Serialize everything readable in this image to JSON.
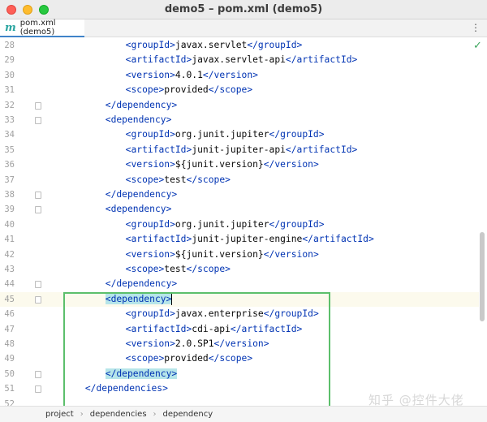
{
  "window": {
    "title": "demo5 – pom.xml (demo5)"
  },
  "tab": {
    "icon": "m",
    "label": "pom.xml (demo5)",
    "menu": "⋮"
  },
  "editor": {
    "status_icon": "✓",
    "lines": [
      {
        "num": "28",
        "indent": 6,
        "parts": [
          [
            "t",
            "<"
          ],
          [
            "n",
            "groupId"
          ],
          [
            "t",
            ">"
          ],
          [
            "x",
            "javax.servlet"
          ],
          [
            "t",
            "</"
          ],
          [
            "n",
            "groupId"
          ],
          [
            "t",
            ">"
          ]
        ]
      },
      {
        "num": "29",
        "indent": 6,
        "parts": [
          [
            "t",
            "<"
          ],
          [
            "n",
            "artifactId"
          ],
          [
            "t",
            ">"
          ],
          [
            "x",
            "javax.servlet-api"
          ],
          [
            "t",
            "</"
          ],
          [
            "n",
            "artifactId"
          ],
          [
            "t",
            ">"
          ]
        ]
      },
      {
        "num": "30",
        "indent": 6,
        "parts": [
          [
            "t",
            "<"
          ],
          [
            "n",
            "version"
          ],
          [
            "t",
            ">"
          ],
          [
            "x",
            "4.0.1"
          ],
          [
            "t",
            "</"
          ],
          [
            "n",
            "version"
          ],
          [
            "t",
            ">"
          ]
        ]
      },
      {
        "num": "31",
        "indent": 6,
        "parts": [
          [
            "t",
            "<"
          ],
          [
            "n",
            "scope"
          ],
          [
            "t",
            ">"
          ],
          [
            "x",
            "provided"
          ],
          [
            "t",
            "</"
          ],
          [
            "n",
            "scope"
          ],
          [
            "t",
            ">"
          ]
        ]
      },
      {
        "num": "32",
        "indent": 4,
        "fold": true,
        "parts": [
          [
            "t",
            "</"
          ],
          [
            "n",
            "dependency"
          ],
          [
            "t",
            ">"
          ]
        ]
      },
      {
        "num": "33",
        "indent": 4,
        "fold": true,
        "parts": [
          [
            "t",
            "<"
          ],
          [
            "n",
            "dependency"
          ],
          [
            "t",
            ">"
          ]
        ]
      },
      {
        "num": "34",
        "indent": 6,
        "parts": [
          [
            "t",
            "<"
          ],
          [
            "n",
            "groupId"
          ],
          [
            "t",
            ">"
          ],
          [
            "x",
            "org.junit.jupiter"
          ],
          [
            "t",
            "</"
          ],
          [
            "n",
            "groupId"
          ],
          [
            "t",
            ">"
          ]
        ]
      },
      {
        "num": "35",
        "indent": 6,
        "parts": [
          [
            "t",
            "<"
          ],
          [
            "n",
            "artifactId"
          ],
          [
            "t",
            ">"
          ],
          [
            "x",
            "junit-jupiter-api"
          ],
          [
            "t",
            "</"
          ],
          [
            "n",
            "artifactId"
          ],
          [
            "t",
            ">"
          ]
        ]
      },
      {
        "num": "36",
        "indent": 6,
        "parts": [
          [
            "t",
            "<"
          ],
          [
            "n",
            "version"
          ],
          [
            "t",
            ">"
          ],
          [
            "x",
            "${junit.version}"
          ],
          [
            "t",
            "</"
          ],
          [
            "n",
            "version"
          ],
          [
            "t",
            ">"
          ]
        ]
      },
      {
        "num": "37",
        "indent": 6,
        "parts": [
          [
            "t",
            "<"
          ],
          [
            "n",
            "scope"
          ],
          [
            "t",
            ">"
          ],
          [
            "x",
            "test"
          ],
          [
            "t",
            "</"
          ],
          [
            "n",
            "scope"
          ],
          [
            "t",
            ">"
          ]
        ]
      },
      {
        "num": "38",
        "indent": 4,
        "fold": true,
        "parts": [
          [
            "t",
            "</"
          ],
          [
            "n",
            "dependency"
          ],
          [
            "t",
            ">"
          ]
        ]
      },
      {
        "num": "39",
        "indent": 4,
        "fold": true,
        "parts": [
          [
            "t",
            "<"
          ],
          [
            "n",
            "dependency"
          ],
          [
            "t",
            ">"
          ]
        ]
      },
      {
        "num": "40",
        "indent": 6,
        "parts": [
          [
            "t",
            "<"
          ],
          [
            "n",
            "groupId"
          ],
          [
            "t",
            ">"
          ],
          [
            "x",
            "org.junit.jupiter"
          ],
          [
            "t",
            "</"
          ],
          [
            "n",
            "groupId"
          ],
          [
            "t",
            ">"
          ]
        ]
      },
      {
        "num": "41",
        "indent": 6,
        "parts": [
          [
            "t",
            "<"
          ],
          [
            "n",
            "artifactId"
          ],
          [
            "t",
            ">"
          ],
          [
            "x",
            "junit-jupiter-engine"
          ],
          [
            "t",
            "</"
          ],
          [
            "n",
            "artifactId"
          ],
          [
            "t",
            ">"
          ]
        ]
      },
      {
        "num": "42",
        "indent": 6,
        "parts": [
          [
            "t",
            "<"
          ],
          [
            "n",
            "version"
          ],
          [
            "t",
            ">"
          ],
          [
            "x",
            "${junit.version}"
          ],
          [
            "t",
            "</"
          ],
          [
            "n",
            "version"
          ],
          [
            "t",
            ">"
          ]
        ]
      },
      {
        "num": "43",
        "indent": 6,
        "parts": [
          [
            "t",
            "<"
          ],
          [
            "n",
            "scope"
          ],
          [
            "t",
            ">"
          ],
          [
            "x",
            "test"
          ],
          [
            "t",
            "</"
          ],
          [
            "n",
            "scope"
          ],
          [
            "t",
            ">"
          ]
        ]
      },
      {
        "num": "44",
        "indent": 4,
        "fold": true,
        "parts": [
          [
            "t",
            "</"
          ],
          [
            "n",
            "dependency"
          ],
          [
            "t",
            ">"
          ]
        ]
      },
      {
        "num": "45",
        "indent": 4,
        "fold": true,
        "current": true,
        "highlight": true,
        "caret": true,
        "parts": [
          [
            "t",
            "<"
          ],
          [
            "n",
            "dependency"
          ],
          [
            "t",
            ">"
          ]
        ]
      },
      {
        "num": "46",
        "indent": 6,
        "parts": [
          [
            "t",
            "<"
          ],
          [
            "n",
            "groupId"
          ],
          [
            "t",
            ">"
          ],
          [
            "x",
            "javax.enterprise"
          ],
          [
            "t",
            "</"
          ],
          [
            "n",
            "groupId"
          ],
          [
            "t",
            ">"
          ]
        ]
      },
      {
        "num": "47",
        "indent": 6,
        "parts": [
          [
            "t",
            "<"
          ],
          [
            "n",
            "artifactId"
          ],
          [
            "t",
            ">"
          ],
          [
            "x",
            "cdi-api"
          ],
          [
            "t",
            "</"
          ],
          [
            "n",
            "artifactId"
          ],
          [
            "t",
            ">"
          ]
        ]
      },
      {
        "num": "48",
        "indent": 6,
        "parts": [
          [
            "t",
            "<"
          ],
          [
            "n",
            "version"
          ],
          [
            "t",
            ">"
          ],
          [
            "x",
            "2.0.SP1"
          ],
          [
            "t",
            "</"
          ],
          [
            "n",
            "version"
          ],
          [
            "t",
            ">"
          ]
        ]
      },
      {
        "num": "49",
        "indent": 6,
        "parts": [
          [
            "t",
            "<"
          ],
          [
            "n",
            "scope"
          ],
          [
            "t",
            ">"
          ],
          [
            "x",
            "provided"
          ],
          [
            "t",
            "</"
          ],
          [
            "n",
            "scope"
          ],
          [
            "t",
            ">"
          ]
        ]
      },
      {
        "num": "50",
        "indent": 4,
        "fold": true,
        "highlight": true,
        "parts": [
          [
            "t",
            "</"
          ],
          [
            "n",
            "dependency"
          ],
          [
            "t",
            ">"
          ]
        ]
      },
      {
        "num": "51",
        "indent": 2,
        "fold": true,
        "parts": [
          [
            "t",
            "</"
          ],
          [
            "n",
            "dependencies"
          ],
          [
            "t",
            ">"
          ]
        ]
      },
      {
        "num": "52",
        "indent": 0,
        "parts": []
      }
    ]
  },
  "breadcrumb": [
    "project",
    "dependencies",
    "dependency"
  ],
  "watermark": "知乎 @控件大佬",
  "colors": {
    "tag": "#0033b3",
    "highlight": "#b6e5e9",
    "selection_border": "#5cbf6b",
    "current_line": "#fcfaed"
  }
}
